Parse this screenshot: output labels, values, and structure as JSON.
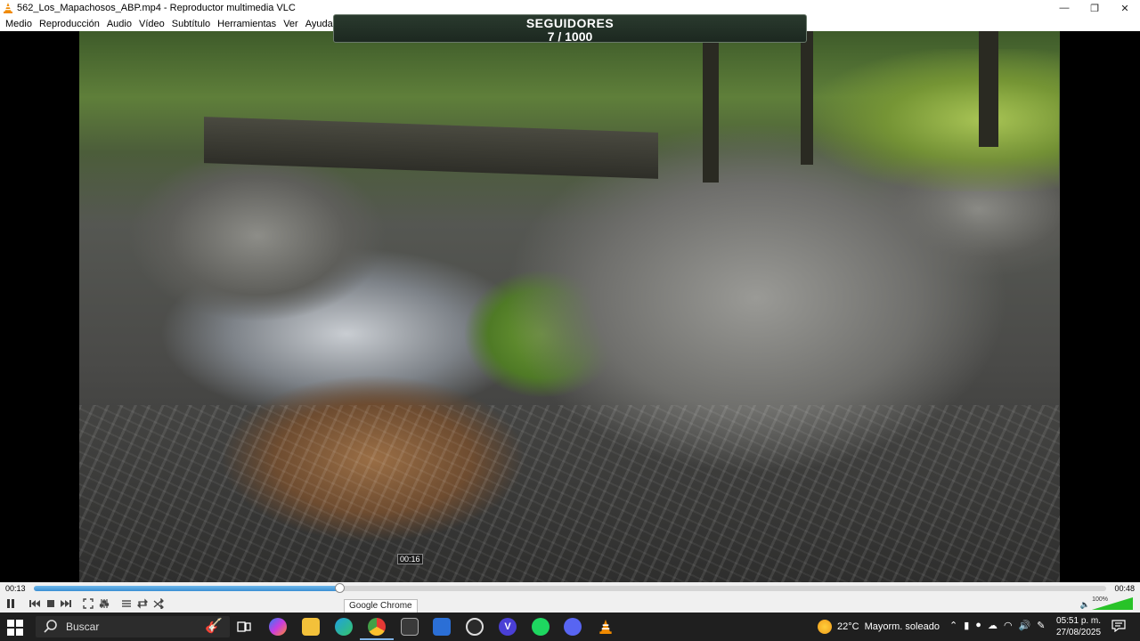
{
  "window": {
    "title": "562_Los_Mapachosos_ABP.mp4 - Reproductor multimedia VLC",
    "minimize": "—",
    "maximize": "❐",
    "close": "✕"
  },
  "menu": {
    "items": [
      "Medio",
      "Reproducción",
      "Audio",
      "Vídeo",
      "Subtítulo",
      "Herramientas",
      "Ver",
      "Ayuda"
    ]
  },
  "overlay": {
    "title": "SEGUIDORES",
    "count": "7 / 1000"
  },
  "player": {
    "elapsed": "00:13",
    "total": "00:48",
    "hover_time": "00:16",
    "progress": 0.285,
    "volume_percent": "100%",
    "volume_level": 1.0,
    "buttons": {
      "pause": "pause-icon",
      "previous": "previous-icon",
      "stop": "stop-icon",
      "next": "next-icon",
      "fullscreen": "fullscreen-icon",
      "extended": "equalizer-icon",
      "playlist": "playlist-icon",
      "loop": "loop-icon",
      "random": "shuffle-icon"
    }
  },
  "tooltip": {
    "chrome": "Google Chrome"
  },
  "taskbar": {
    "search_placeholder": "Buscar",
    "weather_temp": "22°C",
    "weather_desc": "Mayorm. soleado",
    "time": "05:51 p. m.",
    "date": "27/08/2025",
    "accent": "#7fb3e6"
  }
}
